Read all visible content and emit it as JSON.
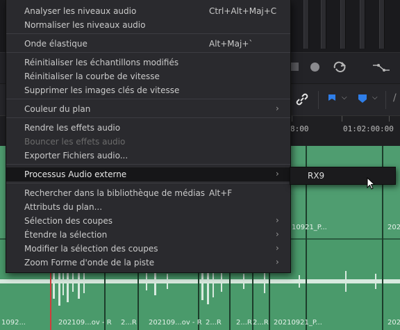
{
  "menu": {
    "items": [
      {
        "label": "Analyser les niveaux audio",
        "shortcut": "Ctrl+Alt+Maj+C"
      },
      {
        "label": "Normaliser les niveaux audio"
      },
      {
        "label": "Onde élastique",
        "shortcut": "Alt+Maj+`"
      },
      {
        "label": "Réinitialiser les échantillons modifiés"
      },
      {
        "label": "Réinitialiser la courbe de vitesse"
      },
      {
        "label": "Supprimer les images clés de vitesse"
      },
      {
        "label": "Couleur du plan"
      },
      {
        "label": "Rendre les effets audio"
      },
      {
        "label": "Bouncer les effets audio"
      },
      {
        "label": "Exporter Fichiers audio..."
      },
      {
        "label": "Processus Audio externe"
      },
      {
        "label": "Rechercher dans la bibliothèque de médias",
        "shortcut": "Alt+F"
      },
      {
        "label": "Attributs du plan..."
      },
      {
        "label": "Sélection des coupes"
      },
      {
        "label": "Étendre la sélection"
      },
      {
        "label": "Modifier la sélection des coupes"
      },
      {
        "label": "Zoom Forme d'onde de la piste"
      }
    ]
  },
  "submenu": {
    "label": "RX9"
  },
  "timeline": {
    "timecode_1": "8:00",
    "timecode_2": "01:02:00:00",
    "upper_clip_label_1": "10921_P...",
    "upper_clip_label_2": "202",
    "lower_clip_labels": [
      "1092...",
      "202109...ov - R",
      "2...R",
      "202109...ov - R",
      "2...R",
      "2...R",
      "2...R",
      "20210921_P...",
      "202"
    ]
  },
  "colors": {
    "menu_bg": "#2a2a2e",
    "highlight_bg": "#161618",
    "track_green": "#4f9d70",
    "playhead_red": "#d23b3b",
    "marker_blue": "#2f7ee8"
  }
}
